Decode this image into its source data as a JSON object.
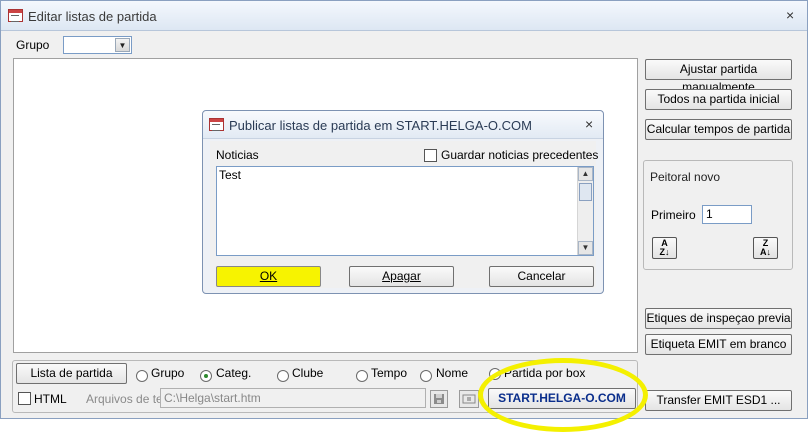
{
  "window": {
    "title": "Editar listas de partida",
    "close_glyph": "×"
  },
  "grupo_label": "Grupo",
  "right_buttons": {
    "ajustar": "Ajustar partida manualmente",
    "todos": "Todos na partida inicial",
    "calcular": "Calcular tempos de partida",
    "etiques": "Etiques de inspeçao previa",
    "etiqueta": "Etiqueta EMIT em branco",
    "transfer": "Transfer EMIT ESD1 ..."
  },
  "peitoral": {
    "title": "Peitoral novo",
    "primeiro_label": "Primeiro",
    "primeiro_value": "1",
    "sort_az": "A\nZ↓",
    "sort_za": "Z\nA↓"
  },
  "bottom": {
    "lista_button": "Lista de partida",
    "radios": [
      {
        "label": "Grupo",
        "selected": false
      },
      {
        "label": "Categ.",
        "selected": true
      },
      {
        "label": "Clube",
        "selected": false
      },
      {
        "label": "Tempo",
        "selected": false
      },
      {
        "label": "Nome",
        "selected": false
      },
      {
        "label": "Partida por box",
        "selected": false
      }
    ],
    "html_label": "HTML",
    "arquivos_label": "Arquivos de te",
    "path_value": "C:\\Helga\\start.htm",
    "start_button": "START.HELGA-O.COM"
  },
  "dialog": {
    "title": "Publicar listas de partida em START.HELGA-O.COM",
    "close_glyph": "×",
    "noticias_label": "Noticias",
    "guardar_label": "Guardar noticias precedentes",
    "memo_text": "Test",
    "ok": "OK",
    "apagar": "Apagar",
    "cancelar": "Cancelar"
  },
  "colors": {
    "highlight": "#f4f000",
    "start_text": "#0a2e8c"
  }
}
